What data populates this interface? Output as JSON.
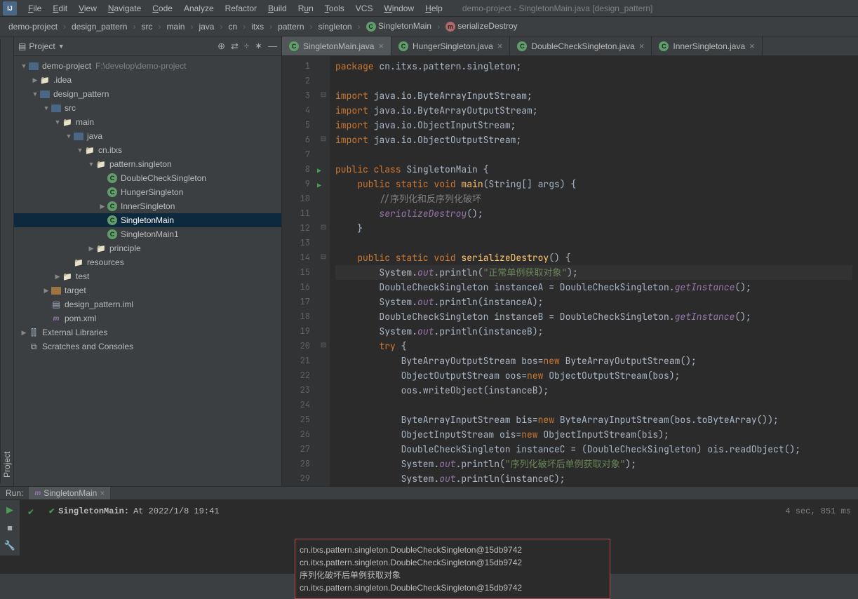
{
  "window_title": "demo-project - SingletonMain.java [design_pattern]",
  "menu": [
    "File",
    "Edit",
    "View",
    "Navigate",
    "Code",
    "Analyze",
    "Refactor",
    "Build",
    "Run",
    "Tools",
    "VCS",
    "Window",
    "Help"
  ],
  "menu_underline": [
    0,
    0,
    0,
    0,
    0,
    -1,
    -1,
    0,
    1,
    0,
    -1,
    0,
    0
  ],
  "breadcrumb": [
    {
      "label": "demo-project"
    },
    {
      "label": "design_pattern"
    },
    {
      "label": "src"
    },
    {
      "label": "main"
    },
    {
      "label": "java"
    },
    {
      "label": "cn"
    },
    {
      "label": "itxs"
    },
    {
      "label": "pattern"
    },
    {
      "label": "singleton"
    },
    {
      "label": "SingletonMain",
      "type": "class"
    },
    {
      "label": "serializeDestroy",
      "type": "method"
    }
  ],
  "project_panel": {
    "title": "Project",
    "actions": [
      "⊕",
      "⇄",
      "÷",
      "✶",
      "—"
    ]
  },
  "tree": [
    {
      "d": 0,
      "arrow": "▼",
      "icon": "module",
      "label": "demo-project",
      "suffix": "F:\\develop\\demo-project"
    },
    {
      "d": 1,
      "arrow": "▶",
      "icon": "folder",
      "label": ".idea"
    },
    {
      "d": 1,
      "arrow": "▼",
      "icon": "module",
      "label": "design_pattern"
    },
    {
      "d": 2,
      "arrow": "▼",
      "icon": "folder-blue",
      "label": "src"
    },
    {
      "d": 3,
      "arrow": "▼",
      "icon": "folder",
      "label": "main"
    },
    {
      "d": 4,
      "arrow": "▼",
      "icon": "folder-blue",
      "label": "java"
    },
    {
      "d": 5,
      "arrow": "▼",
      "icon": "folder",
      "label": "cn.itxs"
    },
    {
      "d": 6,
      "arrow": "▼",
      "icon": "folder",
      "label": "pattern.singleton"
    },
    {
      "d": 7,
      "arrow": "",
      "icon": "class",
      "label": "DoubleCheckSingleton"
    },
    {
      "d": 7,
      "arrow": "",
      "icon": "class",
      "label": "HungerSingleton"
    },
    {
      "d": 7,
      "arrow": "▶",
      "icon": "class",
      "label": "InnerSingleton"
    },
    {
      "d": 7,
      "arrow": "",
      "icon": "class",
      "label": "SingletonMain",
      "selected": true
    },
    {
      "d": 7,
      "arrow": "",
      "icon": "class",
      "label": "SingletonMain1"
    },
    {
      "d": 6,
      "arrow": "▶",
      "icon": "folder",
      "label": "principle"
    },
    {
      "d": 4,
      "arrow": "",
      "icon": "folder",
      "label": "resources"
    },
    {
      "d": 3,
      "arrow": "▶",
      "icon": "folder",
      "label": "test"
    },
    {
      "d": 2,
      "arrow": "▶",
      "icon": "folder-orange",
      "label": "target"
    },
    {
      "d": 2,
      "arrow": "",
      "icon": "file",
      "label": "design_pattern.iml"
    },
    {
      "d": 2,
      "arrow": "",
      "icon": "maven",
      "label": "pom.xml"
    },
    {
      "d": 0,
      "arrow": "▶",
      "icon": "lib",
      "label": "External Libraries"
    },
    {
      "d": 0,
      "arrow": "",
      "icon": "scratch",
      "label": "Scratches and Consoles"
    }
  ],
  "tabs": [
    {
      "label": "SingletonMain.java",
      "active": true
    },
    {
      "label": "HungerSingleton.java"
    },
    {
      "label": "DoubleCheckSingleton.java"
    },
    {
      "label": "InnerSingleton.java"
    }
  ],
  "code": {
    "lines": [
      {
        "n": 1,
        "mark": "",
        "html": "<span class='kw'>package</span> <span class='pkg'>cn.itxs.pattern.singleton</span>;"
      },
      {
        "n": 2,
        "mark": "",
        "html": ""
      },
      {
        "n": 3,
        "mark": "⊟",
        "html": "<span class='kw'>import</span> <span class='pkg'>java.io.ByteArrayInputStream</span>;"
      },
      {
        "n": 4,
        "mark": "",
        "html": "<span class='kw'>import</span> <span class='pkg'>java.io.ByteArrayOutputStream</span>;"
      },
      {
        "n": 5,
        "mark": "",
        "html": "<span class='kw'>import</span> <span class='pkg'>java.io.ObjectInputStream</span>;"
      },
      {
        "n": 6,
        "mark": "⊟",
        "html": "<span class='kw'>import</span> <span class='pkg'>java.io.ObjectOutputStream</span>;"
      },
      {
        "n": 7,
        "mark": "",
        "html": ""
      },
      {
        "n": 8,
        "mark": "▶",
        "html": "<span class='kw'>public class</span> <span class='cls'>SingletonMain</span> {"
      },
      {
        "n": 9,
        "mark": "▶",
        "html": "    <span class='kw'>public static void</span> <span class='fn'>main</span>(String[] args) {"
      },
      {
        "n": 10,
        "mark": "",
        "html": "        <span class='cmt'>//序列化和反序列化破坏</span>"
      },
      {
        "n": 11,
        "mark": "",
        "html": "        <span class='fld'>serializeDestroy</span>();"
      },
      {
        "n": 12,
        "mark": "⊟",
        "html": "    }"
      },
      {
        "n": 13,
        "mark": "",
        "html": ""
      },
      {
        "n": 14,
        "mark": "⊟",
        "html": "    <span class='kw'>public static void</span> <span class='fn'>serializeDestroy</span>() {"
      },
      {
        "n": 15,
        "mark": "",
        "hl": true,
        "html": "        System.<span class='fld'>out</span>.println(<span class='str'>\"正常单例获取对象\"</span>);"
      },
      {
        "n": 16,
        "mark": "",
        "html": "        DoubleCheckSingleton instanceA = DoubleCheckSingleton.<span class='fld'>getInstance</span>();"
      },
      {
        "n": 17,
        "mark": "",
        "html": "        System.<span class='fld'>out</span>.println(instanceA);"
      },
      {
        "n": 18,
        "mark": "",
        "html": "        DoubleCheckSingleton instanceB = DoubleCheckSingleton.<span class='fld'>getInstance</span>();"
      },
      {
        "n": 19,
        "mark": "",
        "html": "        System.<span class='fld'>out</span>.println(instanceB);"
      },
      {
        "n": 20,
        "mark": "⊟",
        "html": "        <span class='kw'>try</span> {"
      },
      {
        "n": 21,
        "mark": "",
        "html": "            ByteArrayOutputStream bos=<span class='kw'>new</span> ByteArrayOutputStream();"
      },
      {
        "n": 22,
        "mark": "",
        "html": "            ObjectOutputStream oos=<span class='kw'>new</span> ObjectOutputStream(bos);"
      },
      {
        "n": 23,
        "mark": "",
        "html": "            oos.writeObject(instanceB);"
      },
      {
        "n": 24,
        "mark": "",
        "html": ""
      },
      {
        "n": 25,
        "mark": "",
        "html": "            ByteArrayInputStream bis=<span class='kw'>new</span> ByteArrayInputStream(bos.toByteArray());"
      },
      {
        "n": 26,
        "mark": "",
        "html": "            ObjectInputStream ois=<span class='kw'>new</span> ObjectInputStream(bis);"
      },
      {
        "n": 27,
        "mark": "",
        "html": "            DoubleCheckSingleton instanceC = (DoubleCheckSingleton) ois.readObject();"
      },
      {
        "n": 28,
        "mark": "",
        "html": "            System.<span class='fld'>out</span>.println(<span class='str'>\"序列化破坏后单例获取对象\"</span>);"
      },
      {
        "n": 29,
        "mark": "",
        "html": "            System.<span class='fld'>out</span>.println(instanceC);"
      }
    ]
  },
  "run": {
    "header_label": "Run:",
    "tab_name": "SingletonMain",
    "status_name": "SingletonMain:",
    "status_time": "At 2022/1/8 19:41",
    "status_duration": "4 sec, 851 ms",
    "output": [
      "cn.itxs.pattern.singleton.DoubleCheckSingleton@15db9742",
      "cn.itxs.pattern.singleton.DoubleCheckSingleton@15db9742",
      "序列化破坏后单例获取对象",
      "cn.itxs.pattern.singleton.DoubleCheckSingleton@15db9742"
    ]
  },
  "side_rail": "Project"
}
